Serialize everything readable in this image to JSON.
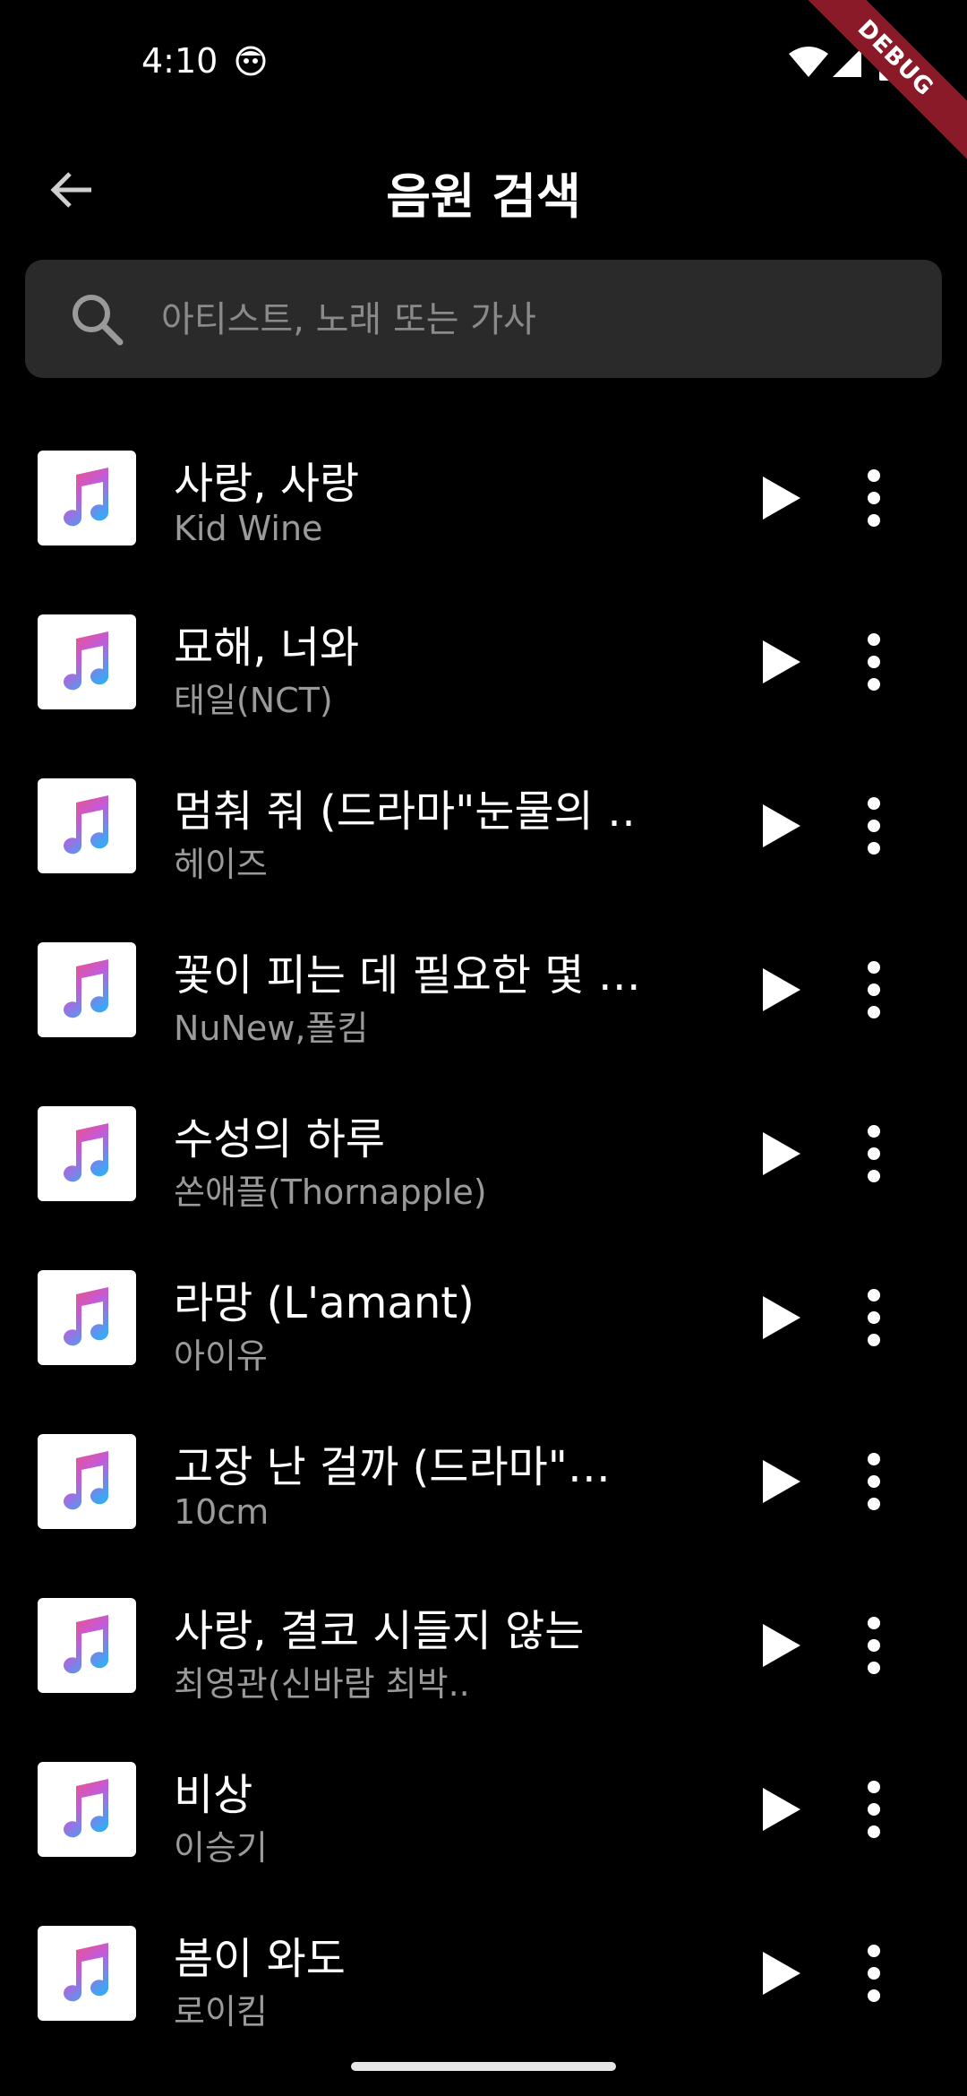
{
  "status_bar": {
    "time": "4:10",
    "debug_label": "DEBUG"
  },
  "header": {
    "title": "음원 검색",
    "back_icon": "arrow-left-icon"
  },
  "search": {
    "placeholder": "아티스트, 노래 또는 가사",
    "value": "",
    "icon": "search-icon"
  },
  "colors": {
    "background": "#000000",
    "search_bg": "#2a2a2a",
    "secondary_text": "#9a9a9a",
    "debug_ribbon": "#8a1a28"
  },
  "songs": [
    {
      "title": "사랑, 사랑",
      "artist": "Kid Wine"
    },
    {
      "title": "묘해, 너와",
      "artist": "태일(NCT)"
    },
    {
      "title": "멈춰 줘 (드라마\"눈물의 …",
      "artist": "헤이즈"
    },
    {
      "title": "꽃이 피는 데 필요한 몇 …",
      "artist": "NuNew,폴킴"
    },
    {
      "title": "수성의 하루",
      "artist": "쏜애플(Thornapple)"
    },
    {
      "title": "라망 (L'amant)",
      "artist": "아이유"
    },
    {
      "title": "고장 난 걸까 (드라마\"…",
      "artist": "10cm"
    },
    {
      "title": "사랑, 결코 시들지 않는",
      "artist": "최영관(신바람 최박.."
    },
    {
      "title": "비상",
      "artist": "이승기"
    },
    {
      "title": "봄이 와도",
      "artist": "로이킴"
    }
  ]
}
